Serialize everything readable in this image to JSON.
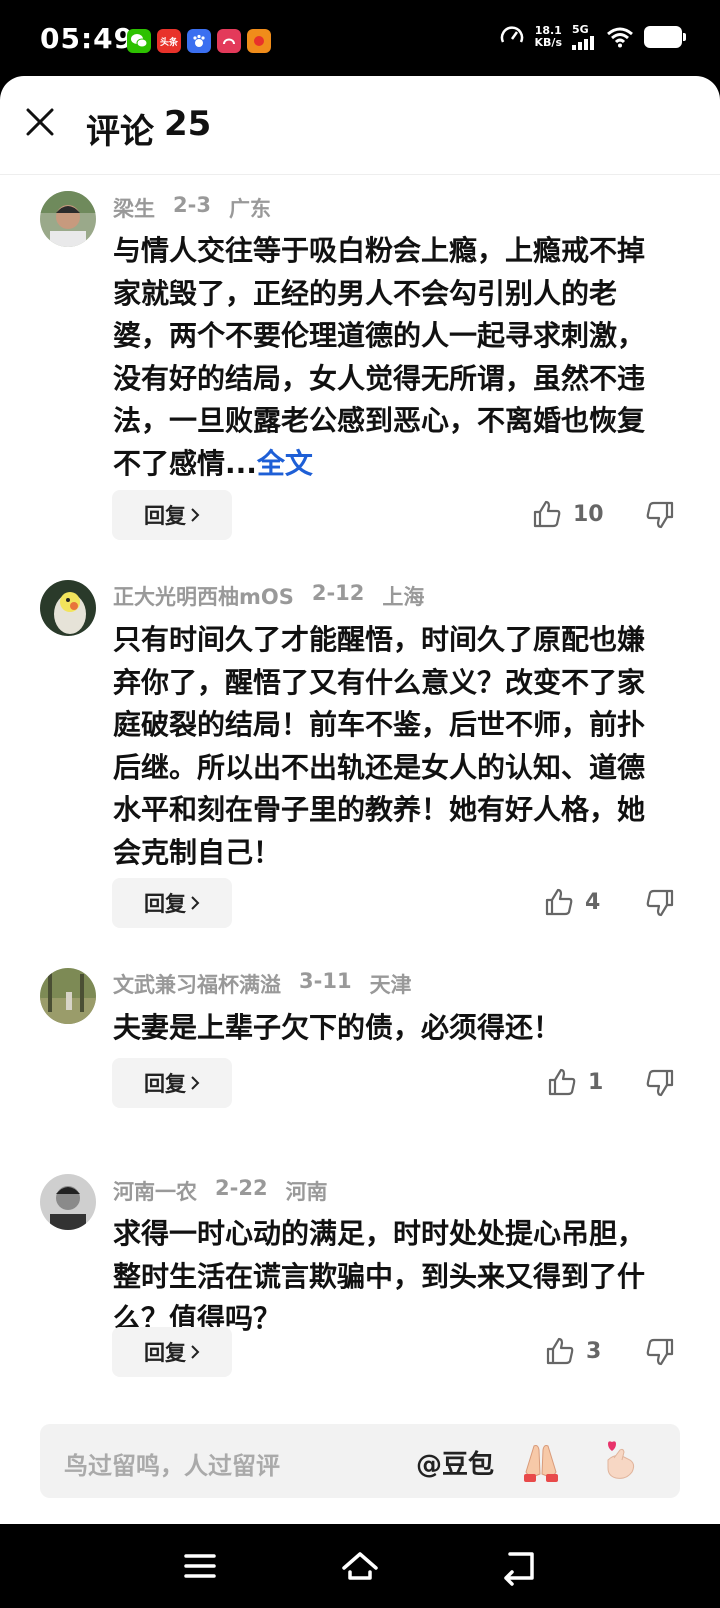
{
  "status_bar": {
    "time": "05:49",
    "apps": [
      {
        "name": "wechat-icon",
        "label": "",
        "color": "#2dc100"
      },
      {
        "name": "toutiao-icon",
        "label": "头条",
        "color": "#e8322a"
      },
      {
        "name": "baidu-icon",
        "label": "",
        "color": "#3b6ff0"
      },
      {
        "name": "app-red-icon",
        "label": "",
        "color": "#e33a5a"
      },
      {
        "name": "app-orange-icon",
        "label": "",
        "color": "#f08c1a"
      }
    ],
    "speed_value": "18.1",
    "speed_unit": "KB/s",
    "network": "5G"
  },
  "header": {
    "title": "评论",
    "count": "25"
  },
  "comments": [
    {
      "author": "梁生",
      "date": "2-3",
      "location": "广东",
      "text": "与情人交往等于吸白粉会上瘾，上瘾戒不掉家就毁了，正经的男人不会勾引别人的老婆，两个不要伦理道德的人一起寻求刺激，没有好的结局，女人觉得无所谓，虽然不违法，一旦败露老公感到恶心，不离婚也恢复不了感情...",
      "full_text_label": "全文",
      "reply_label": "回复",
      "likes": "10"
    },
    {
      "author": "正大光明西柚mOS",
      "date": "2-12",
      "location": "上海",
      "text": "只有时间久了才能醒悟，时间久了原配也嫌弃你了，醒悟了又有什么意义？改变不了家庭破裂的结局！前车不鉴，后世不师，前扑后继。所以出不出轨还是女人的认知、道德水平和刻在骨子里的教养！她有好人格，她会克制自己！",
      "reply_label": "回复",
      "likes": "4"
    },
    {
      "author": "文武兼习福杯满溢",
      "date": "3-11",
      "location": "天津",
      "text": "夫妻是上辈子欠下的债，必须得还！",
      "reply_label": "回复",
      "likes": "1"
    },
    {
      "author": "河南一农",
      "date": "2-22",
      "location": "河南",
      "text": "求得一时心动的满足，时时处处提心吊胆，整时生活在谎言欺骗中，到头来又得到了什么？值得吗？",
      "reply_label": "回复",
      "likes": "3"
    }
  ],
  "input": {
    "placeholder": "鸟过留鸣，人过留评",
    "mention_label": "@豆包"
  },
  "colors": {
    "link": "#1e5fd6",
    "meta": "#999999",
    "text": "#111111"
  }
}
